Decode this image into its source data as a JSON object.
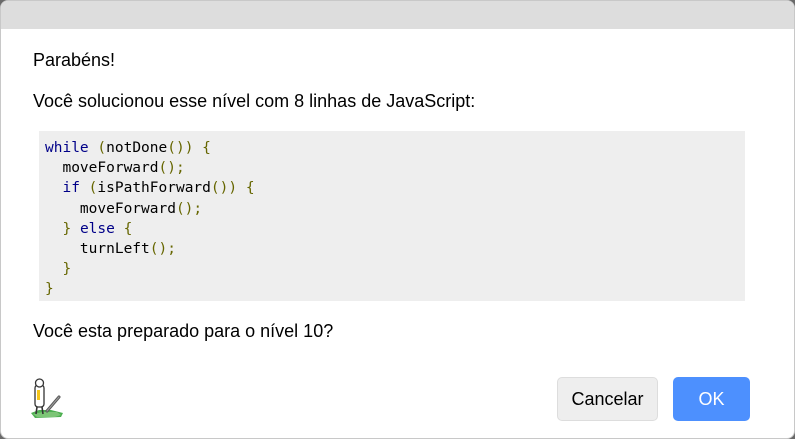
{
  "dialog": {
    "heading": "Parabéns!",
    "summary": "Você solucionou esse nível com 8 linhas de JavaScript:",
    "question": "Você esta preparado para o nível 10?",
    "footer_icon": "pegman-icon",
    "cancel_label": "Cancelar",
    "ok_label": "OK"
  },
  "code": {
    "lines": [
      [
        {
          "t": "while",
          "c": "kw"
        },
        {
          "t": " ",
          "c": "pl"
        },
        {
          "t": "(",
          "c": "pn"
        },
        {
          "t": "notDone",
          "c": "pl"
        },
        {
          "t": "())",
          "c": "pn"
        },
        {
          "t": " ",
          "c": "pl"
        },
        {
          "t": "{",
          "c": "pn"
        }
      ],
      [
        {
          "t": "  moveForward",
          "c": "pl"
        },
        {
          "t": "();",
          "c": "pn"
        }
      ],
      [
        {
          "t": "  ",
          "c": "pl"
        },
        {
          "t": "if",
          "c": "kw"
        },
        {
          "t": " ",
          "c": "pl"
        },
        {
          "t": "(",
          "c": "pn"
        },
        {
          "t": "isPathForward",
          "c": "pl"
        },
        {
          "t": "())",
          "c": "pn"
        },
        {
          "t": " ",
          "c": "pl"
        },
        {
          "t": "{",
          "c": "pn"
        }
      ],
      [
        {
          "t": "    moveForward",
          "c": "pl"
        },
        {
          "t": "();",
          "c": "pn"
        }
      ],
      [
        {
          "t": "  ",
          "c": "pl"
        },
        {
          "t": "}",
          "c": "pn"
        },
        {
          "t": " ",
          "c": "pl"
        },
        {
          "t": "else",
          "c": "kw"
        },
        {
          "t": " ",
          "c": "pl"
        },
        {
          "t": "{",
          "c": "pn"
        }
      ],
      [
        {
          "t": "    turnLeft",
          "c": "pl"
        },
        {
          "t": "();",
          "c": "pn"
        }
      ],
      [
        {
          "t": "  ",
          "c": "pl"
        },
        {
          "t": "}",
          "c": "pn"
        }
      ],
      [
        {
          "t": "}",
          "c": "pn"
        }
      ]
    ]
  },
  "colors": {
    "ok_button": "#4d90fe",
    "keyword": "#000088",
    "punctuation": "#666600",
    "code_background": "#eeeeee"
  }
}
